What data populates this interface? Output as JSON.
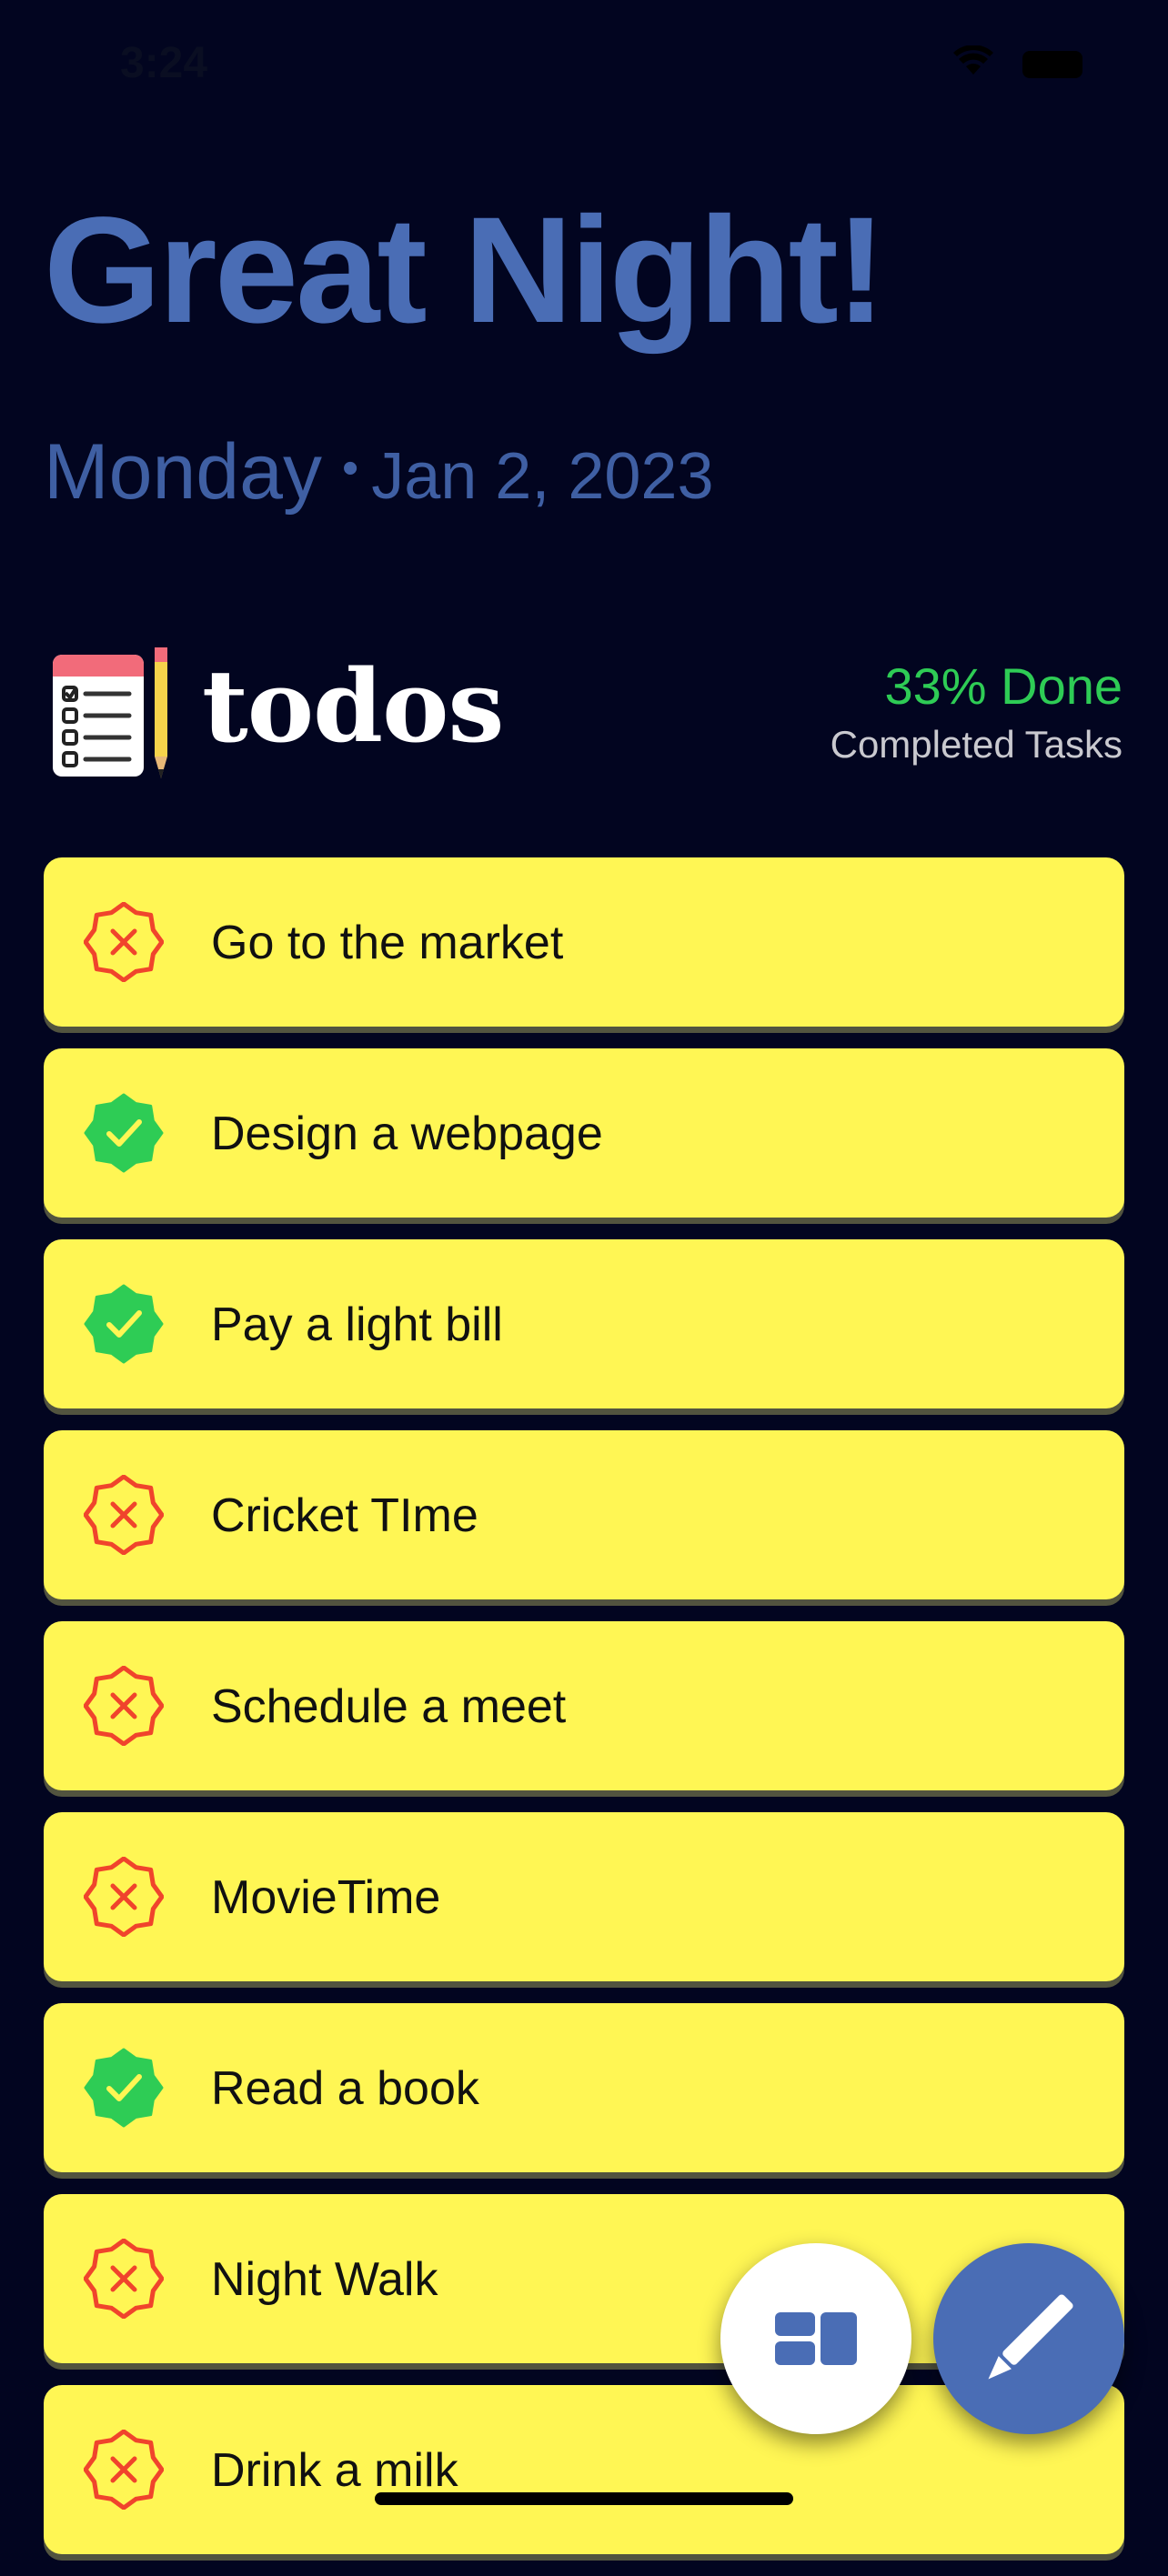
{
  "status_bar": {
    "time": "3:24",
    "wifi_icon": "wifi-icon",
    "battery_icon": "battery-icon"
  },
  "header": {
    "greeting": "Great Night!",
    "day": "Monday",
    "separator": "•",
    "date": "Jan 2, 2023"
  },
  "app": {
    "logo_icon": "checklist-pencil-icon",
    "title": "todos",
    "progress_text": "33% Done",
    "progress_label": "Completed Tasks"
  },
  "todos": [
    {
      "label": "Go to the market",
      "done": false
    },
    {
      "label": "Design a webpage",
      "done": true
    },
    {
      "label": "Pay a light bill",
      "done": true
    },
    {
      "label": "Cricket TIme",
      "done": false
    },
    {
      "label": "Schedule a meet",
      "done": false
    },
    {
      "label": "MovieTime",
      "done": false
    },
    {
      "label": "Read a book",
      "done": true
    },
    {
      "label": "Night Walk",
      "done": false
    },
    {
      "label": "Drink a milk",
      "done": false
    }
  ],
  "fabs": {
    "view_icon": "dashboard-view-icon",
    "edit_icon": "pencil-icon"
  },
  "colors": {
    "background": "#020520",
    "accent": "#4A6DB5",
    "done": "#2ECC55",
    "card": "#FFF654",
    "pending": "#F0442C"
  }
}
